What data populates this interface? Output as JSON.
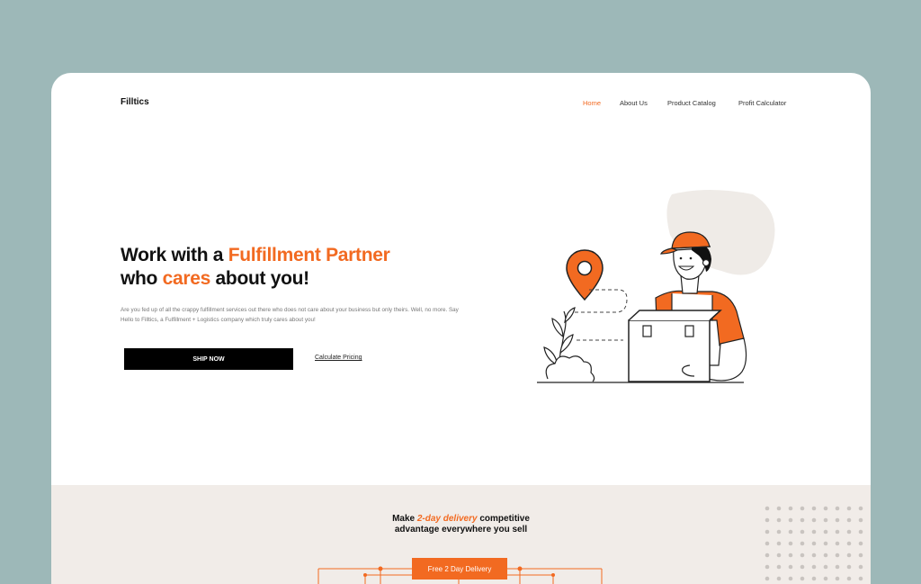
{
  "brand": {
    "name": "Filltics",
    "accent": "#f26a21"
  },
  "nav": {
    "items": [
      {
        "label": "Home",
        "active": true
      },
      {
        "label": "About Us",
        "active": false
      },
      {
        "label": "Product Catalog",
        "active": false
      },
      {
        "label": "Profit Calculator",
        "active": false
      }
    ]
  },
  "hero": {
    "title_part1": "Work with a ",
    "title_highlight1": "Fulfillment Partner",
    "title_part2": "who ",
    "title_highlight2": "cares",
    "title_part3": " about you!",
    "description": "Are you fed up of all the crappy fulfillment services out there who does not care about your business but only theirs. Well, no more. Say Hello to Filltics, a Fulfillment + Logistics company which truly cares about you!",
    "cta_primary": "SHIP NOW",
    "cta_secondary": "Calculate Pricing"
  },
  "section2": {
    "title_part1": "Make ",
    "title_highlight": "2-day delivery",
    "title_part2": " competitive",
    "title_line2": "advantage everywhere you sell",
    "badge": "Free 2 Day Delivery"
  }
}
